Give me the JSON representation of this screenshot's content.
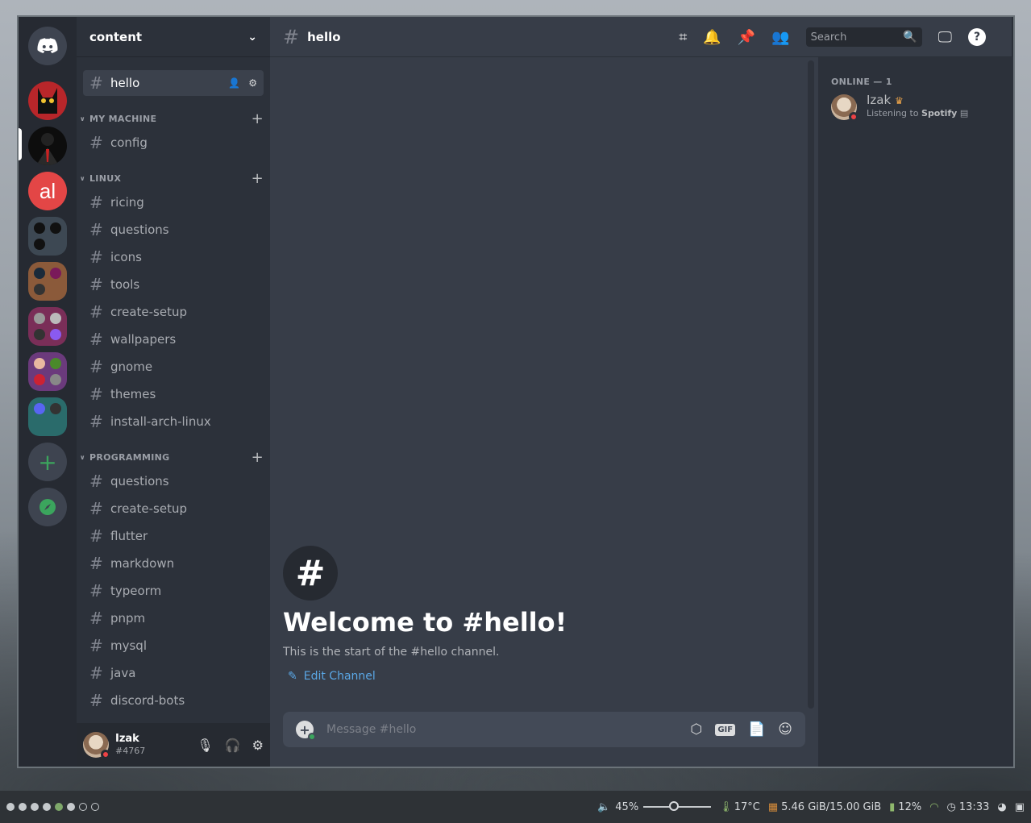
{
  "server": {
    "name": "content"
  },
  "guilds": [
    {
      "id": "home",
      "name": "discord-home-icon"
    },
    {
      "id": "g1",
      "color": "#c42a2a"
    },
    {
      "id": "g2",
      "color": "#111111"
    },
    {
      "id": "g3",
      "color": "#e84545",
      "text": "al"
    },
    {
      "id": "g4",
      "color": "#3d4a55"
    },
    {
      "id": "g5",
      "color": "#8a5a3a"
    },
    {
      "id": "g6",
      "color": "#7a2f5a"
    },
    {
      "id": "g7",
      "color": "#6a3a7a"
    },
    {
      "id": "g8",
      "color": "#2a6a6a"
    }
  ],
  "selected_channel": {
    "name": "hello"
  },
  "categories": {
    "machine": {
      "label": "MY MACHINE",
      "channels": [
        "config"
      ]
    },
    "linux": {
      "label": "LINUX",
      "channels": [
        "ricing",
        "questions",
        "icons",
        "tools",
        "create-setup",
        "wallpapers",
        "gnome",
        "themes",
        "install-arch-linux"
      ]
    },
    "programming": {
      "label": "PROGRAMMING",
      "channels": [
        "questions",
        "create-setup",
        "flutter",
        "markdown",
        "typeorm",
        "pnpm",
        "mysql",
        "java",
        "discord-bots"
      ]
    }
  },
  "user": {
    "name": "Izak",
    "tag": "#4767"
  },
  "topbar": {
    "channel": "hello",
    "search_placeholder": "Search"
  },
  "welcome": {
    "title": "Welcome to #hello!",
    "subtitle": "This is the start of the #hello channel.",
    "edit": "Edit Channel"
  },
  "composer": {
    "placeholder": "Message #hello",
    "gif": "GIF"
  },
  "members": {
    "heading": "ONLINE — 1",
    "list": [
      {
        "name": "Izak",
        "activity_prefix": "Listening to ",
        "activity": "Spotify"
      }
    ]
  },
  "taskbar": {
    "volume": "45%",
    "volume_level": 0.45,
    "temp": "17°C",
    "memory": "5.46 GiB/15.00 GiB",
    "battery": "12%",
    "time": "13:33"
  }
}
